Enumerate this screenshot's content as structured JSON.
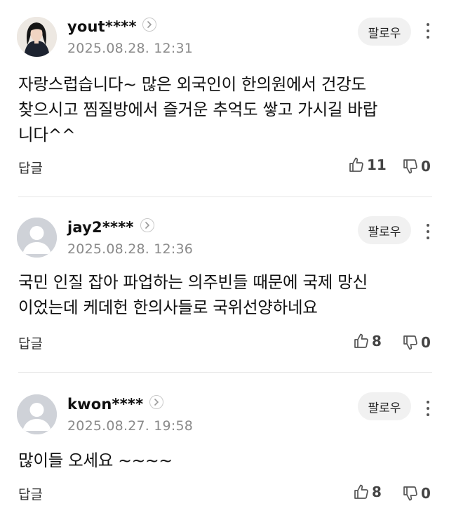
{
  "comments": [
    {
      "username": "yout****",
      "timestamp": "2025.08.28. 12:31",
      "follow_label": "팔로우",
      "body_lines": [
        "자랑스럽습니다~ 많은 외국인이 한의원에서 건강도",
        "찾으시고 찜질방에서 즐거운 추억도 쌓고 가시길 바랍",
        "니다^^"
      ],
      "reply_label": "답글",
      "likes": "11",
      "dislikes": "0",
      "avatar": "user-photo"
    },
    {
      "username": "jay2****",
      "timestamp": "2025.08.28. 12:36",
      "follow_label": "팔로우",
      "body_lines": [
        "국민 인질 잡아 파업하는 의주빈들 때문에 국제 망신",
        "이었는데 케데헌 한의사들로 국위선양하네요"
      ],
      "reply_label": "답글",
      "likes": "8",
      "dislikes": "0",
      "avatar": "default-avatar"
    },
    {
      "username": "kwon****",
      "timestamp": "2025.08.27. 19:58",
      "follow_label": "팔로우",
      "body_lines": [
        "많이들 오세요 ~~~~"
      ],
      "reply_label": "답글",
      "likes": "8",
      "dislikes": "0",
      "avatar": "default-avatar"
    }
  ],
  "icons": {
    "chevron": "chevron-right-icon",
    "more": "more-vertical-icon",
    "like": "thumbs-up-icon",
    "dislike": "thumbs-down-icon"
  }
}
